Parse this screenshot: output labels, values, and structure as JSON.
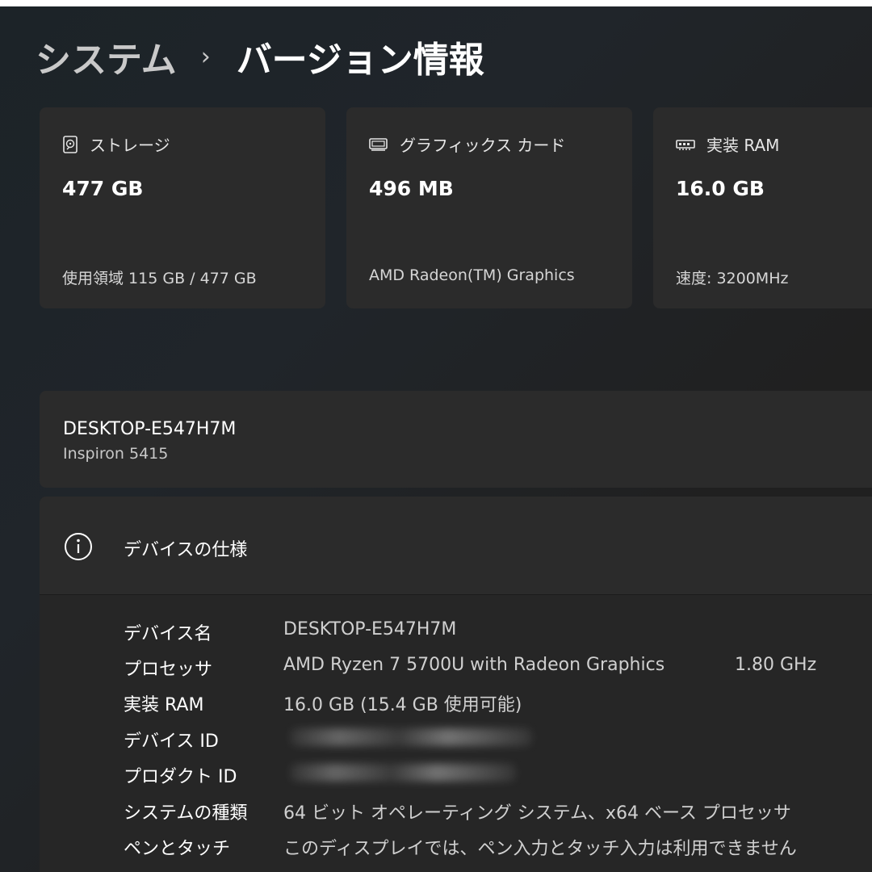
{
  "breadcrumb": {
    "parent": "システム",
    "separator": "›",
    "current": "バージョン情報"
  },
  "cards": [
    {
      "icon": "storage-drive-icon",
      "label": "ストレージ",
      "value": "477 GB",
      "detail": "使用領域 115 GB / 477 GB"
    },
    {
      "icon": "graphics-card-icon",
      "label": "グラフィックス カード",
      "value": "496 MB",
      "detail": "AMD Radeon(TM) Graphics"
    },
    {
      "icon": "ram-module-icon",
      "label": "実装 RAM",
      "value": "16.0 GB",
      "detail": "速度: 3200MHz"
    }
  ],
  "device": {
    "name": "DESKTOP-E547H7M",
    "model": "Inspiron 5415"
  },
  "specs": {
    "header": "デバイスの仕様",
    "rows": [
      {
        "key": "デバイス名",
        "value": "DESKTOP-E547H7M"
      },
      {
        "key": "プロセッサ",
        "value": "AMD Ryzen 7 5700U with Radeon Graphics",
        "value2": "1.80 GHz"
      },
      {
        "key": "実装 RAM",
        "value": "16.0 GB (15.4 GB 使用可能)"
      },
      {
        "key": "デバイス ID",
        "value": ""
      },
      {
        "key": "プロダクト ID",
        "value": ""
      },
      {
        "key": "システムの種類",
        "value": "64 ビット オペレーティング システム、x64 ベース プロセッサ"
      },
      {
        "key": "ペンとタッチ",
        "value": "このディスプレイでは、ペン入力とタッチ入力は利用できません"
      }
    ]
  }
}
